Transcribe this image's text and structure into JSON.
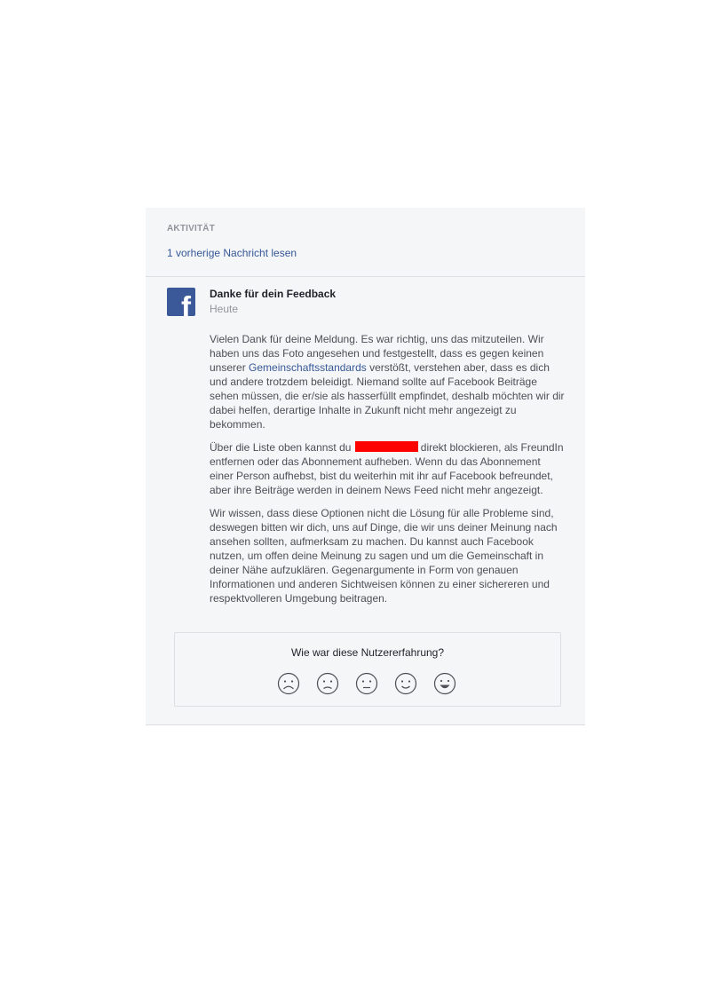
{
  "activity": {
    "label": "AKTIVITÄT",
    "previous_link": "1 vorherige Nachricht lesen"
  },
  "message": {
    "logo_icon": "facebook-logo-icon",
    "title": "Danke für dein Feedback",
    "time": "Heute",
    "p1_before": "Vielen Dank für deine Meldung. Es war richtig, uns das mitzuteilen. Wir haben uns das Foto angesehen und festgestellt, dass es gegen keinen unserer ",
    "p1_link": "Gemeinschaftsstandards",
    "p1_after": " verstößt, verstehen aber, dass es dich und andere trotzdem beleidigt. Niemand sollte auf Facebook Beiträge sehen müssen, die er/sie als hasserfüllt empfindet, deshalb möchten wir dir dabei helfen, derartige Inhalte in Zukunft nicht mehr angezeigt zu bekommen.",
    "p2_before": "Über die Liste oben kannst du ",
    "p2_after": "direkt blockieren, als FreundIn entfernen oder das Abonnement aufheben. Wenn du das Abonnement einer Person aufhebst, bist du weiterhin mit ihr auf Facebook befreundet, aber ihre Beiträge werden in deinem News Feed nicht mehr angezeigt.",
    "p3": "Wir wissen, dass diese Optionen nicht die Lösung für alle Probleme sind, deswegen bitten wir dich, uns auf Dinge, die wir uns deiner Meinung nach ansehen sollten, aufmerksam zu machen. Du kannst auch Facebook nutzen, um offen deine Meinung zu sagen und um die Gemeinschaft in deiner Nähe aufzuklären. Gegenargumente in Form von genauen Informationen und anderen Sichtweisen können zu einer sichereren und respektvolleren Umgebung beitragen."
  },
  "rating": {
    "question": "Wie war diese Nutzererfahrung?",
    "faces": [
      "very-sad-face-icon",
      "sad-face-icon",
      "neutral-face-icon",
      "happy-face-icon",
      "very-happy-face-icon"
    ]
  },
  "colors": {
    "link": "#365899",
    "facebook_blue": "#3b5998",
    "redaction": "#ff0000",
    "panel_bg": "#f5f6f7"
  }
}
